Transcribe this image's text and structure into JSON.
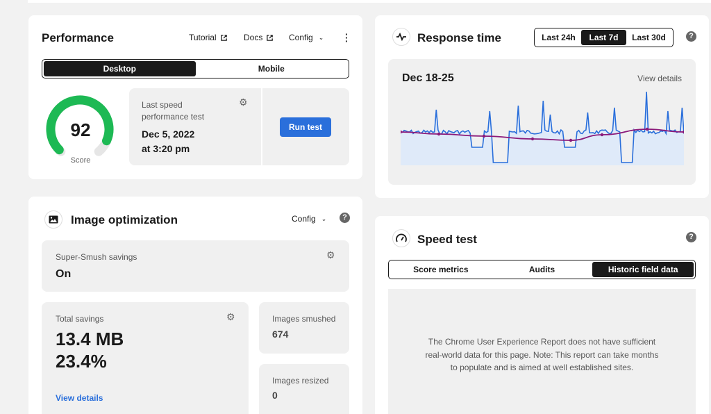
{
  "performance": {
    "title": "Performance",
    "links": {
      "tutorial": "Tutorial",
      "docs": "Docs",
      "config": "Config"
    },
    "device_tabs": [
      "Desktop",
      "Mobile"
    ],
    "score": {
      "value": 92,
      "label": "Score"
    },
    "last_test": {
      "label": "Last speed performance test",
      "date": "Dec 5, 2022",
      "time": "at 3:20 pm"
    },
    "run_test_label": "Run test",
    "colors": {
      "score_green": "#1db954",
      "primary_blue": "#2a6fdb"
    }
  },
  "response_time": {
    "title": "Response time",
    "ranges": [
      "Last 24h",
      "Last 7d",
      "Last 30d"
    ],
    "active_range": "Last 7d",
    "date_range": "Dec 18-25",
    "view_details": "View details",
    "colors": {
      "line": "#2a6fdb",
      "trend": "#8b1a7a",
      "fill": "#dbe8fb"
    }
  },
  "image_opt": {
    "title": "Image optimization",
    "config": "Config",
    "super_smush": {
      "label": "Super-Smush savings",
      "value": "On"
    },
    "total_savings": {
      "label": "Total savings",
      "size": "13.4 MB",
      "percent": "23.4%",
      "view_details": "View details"
    },
    "smushed": {
      "label": "Images smushed",
      "value": "674"
    },
    "resized": {
      "label": "Images resized",
      "value": "0"
    }
  },
  "speed_test": {
    "title": "Speed test",
    "tabs": [
      "Score metrics",
      "Audits",
      "Historic field data"
    ],
    "active_tab": "Historic field data",
    "message_lines": [
      "The Chrome User Experience Report does not have sufficient",
      "real-world data for this page. Note: This report can take months",
      "to populate and is aimed at well established sites."
    ]
  }
}
